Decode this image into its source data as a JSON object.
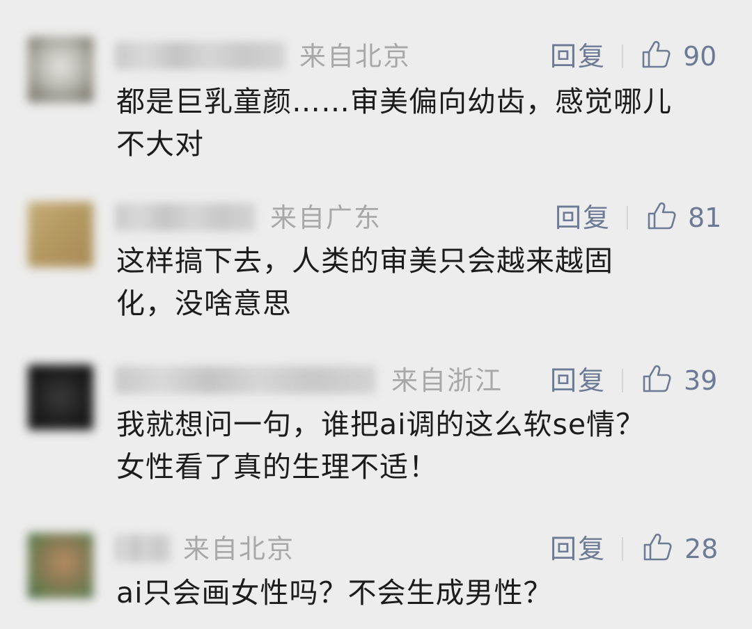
{
  "comments": [
    {
      "location": "来自北京",
      "reply_label": "回复",
      "likes": "90",
      "text": "都是巨乳童颜……审美偏向幼齿，感觉哪儿\n不大对",
      "avatar_colors": [
        "#b9b7b0",
        "#8f8a80",
        "#e3e1dc"
      ]
    },
    {
      "location": "来自广东",
      "reply_label": "回复",
      "likes": "81",
      "text": "这样搞下去，人类的审美只会越来越固\n化，没啥意思",
      "avatar_colors": [
        "#b59a62",
        "#a88a54",
        "#c4ad79"
      ]
    },
    {
      "location": "来自浙江",
      "reply_label": "回复",
      "likes": "39",
      "text": "我就想问一句，谁把ai调的这么软se情？\n女性看了真的生理不适！",
      "avatar_colors": [
        "#1e1e1e",
        "#3a3a3a",
        "#121212"
      ]
    },
    {
      "location": "来自北京",
      "reply_label": "回复",
      "likes": "28",
      "text": "ai只会画女性吗？不会生成男性？",
      "avatar_colors": [
        "#3f5a3c",
        "#b98e63",
        "#6a7d4f"
      ]
    }
  ],
  "colors": {
    "background": "#ededed",
    "text": "#1c1c1c",
    "location": "#a8a8a8",
    "action": "#6c7a95"
  },
  "icons": {
    "like": "thumbs-up-icon"
  }
}
